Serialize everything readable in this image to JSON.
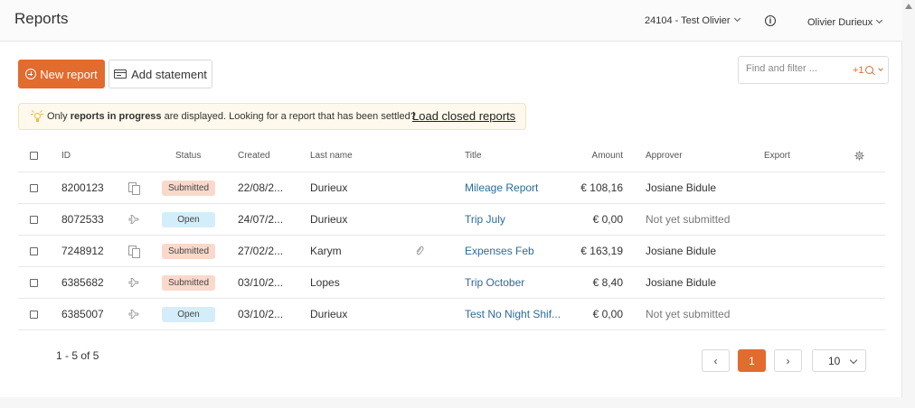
{
  "header": {
    "title": "Reports",
    "company": "24104 - Test Olivier",
    "user": "Olivier Durieux"
  },
  "toolbar": {
    "new_report": "New report",
    "add_statement": "Add statement",
    "search_placeholder": "Find and filter ...",
    "filter_count": "+1"
  },
  "banner": {
    "text_before": "Only ",
    "text_bold": "reports in progress",
    "text_after": " are displayed. Looking for a report that has been settled?",
    "link": "Load closed reports"
  },
  "table": {
    "columns": {
      "id": "ID",
      "status": "Status",
      "created": "Created",
      "last_name": "Last name",
      "title": "Title",
      "amount": "Amount",
      "approver": "Approver",
      "export": "Export"
    },
    "rows": [
      {
        "id": "8200123",
        "type_icon": "copy-icon",
        "status": "Submitted",
        "status_kind": "submitted",
        "created": "22/08/2...",
        "last_name": "Durieux",
        "attachment": false,
        "title": "Mileage Report",
        "amount": "€ 108,16",
        "approver": "Josiane Bidule",
        "approver_muted": false
      },
      {
        "id": "8072533",
        "type_icon": "plane-icon",
        "status": "Open",
        "status_kind": "open",
        "created": "24/07/2...",
        "last_name": "Durieux",
        "attachment": false,
        "title": "Trip July",
        "amount": "€ 0,00",
        "approver": "Not yet submitted",
        "approver_muted": true
      },
      {
        "id": "7248912",
        "type_icon": "copy-icon",
        "status": "Submitted",
        "status_kind": "submitted",
        "created": "27/02/2...",
        "last_name": "Karym",
        "attachment": true,
        "title": "Expenses Feb",
        "amount": "€ 163,19",
        "approver": "Josiane Bidule",
        "approver_muted": false
      },
      {
        "id": "6385682",
        "type_icon": "plane-icon",
        "status": "Submitted",
        "status_kind": "submitted",
        "created": "03/10/2...",
        "last_name": "Lopes",
        "attachment": false,
        "title": "Trip October",
        "amount": "€ 8,40",
        "approver": "Josiane Bidule",
        "approver_muted": false
      },
      {
        "id": "6385007",
        "type_icon": "plane-icon",
        "status": "Open",
        "status_kind": "open",
        "created": "03/10/2...",
        "last_name": "Durieux",
        "attachment": false,
        "title": "Test No Night Shif...",
        "amount": "€ 0,00",
        "approver": "Not yet submitted",
        "approver_muted": true
      }
    ]
  },
  "pagination": {
    "info": "1 - 5 of 5",
    "prev": "‹",
    "current_page": "1",
    "next": "›",
    "page_size": "10"
  }
}
